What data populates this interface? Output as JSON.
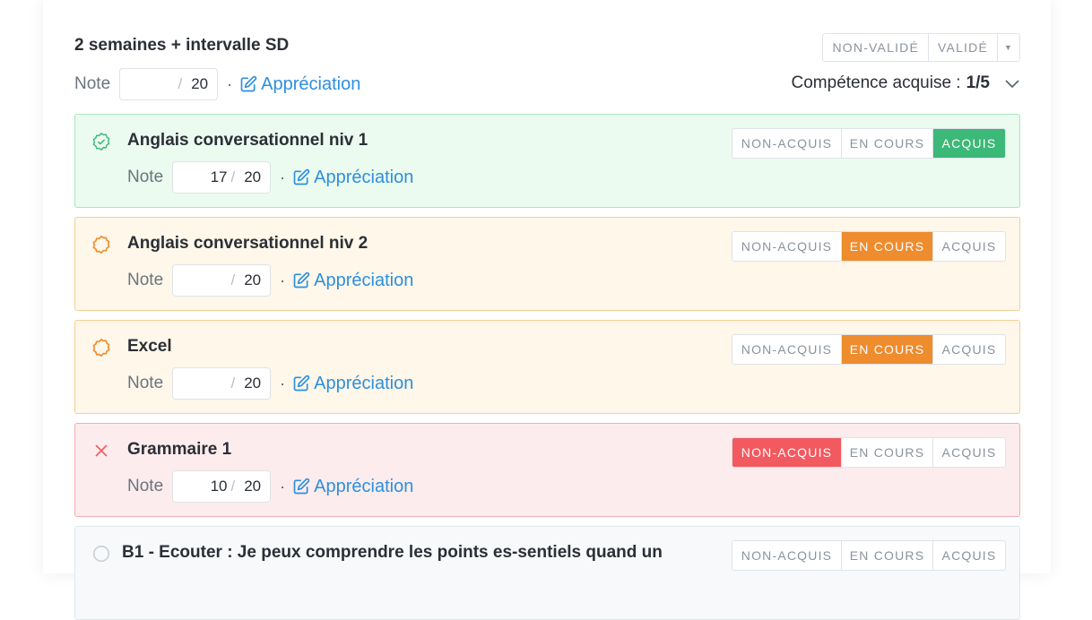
{
  "header": {
    "title": "2 semaines + intervalle SD",
    "validation_options": [
      "NON-VALIDÉ",
      "VALIDÉ"
    ]
  },
  "main_note": {
    "label": "Note",
    "value": "",
    "max": "20",
    "appreciation": "Appréciation"
  },
  "acquired": {
    "label": "Compétence acquise :",
    "count": "1/5"
  },
  "status_options": [
    "NON-ACQUIS",
    "EN COURS",
    "ACQUIS"
  ],
  "competences": [
    {
      "title": "Anglais conversationnel niv 1",
      "note_label": "Note",
      "score": "17",
      "max": "20",
      "appreciation": "Appréciation",
      "status": "ACQUIS",
      "status_color": "#3cb878"
    },
    {
      "title": "Anglais conversationnel niv 2",
      "note_label": "Note",
      "score": "",
      "max": "20",
      "appreciation": "Appréciation",
      "status": "EN COURS",
      "status_color": "#ee8c2e"
    },
    {
      "title": "Excel",
      "note_label": "Note",
      "score": "",
      "max": "20",
      "appreciation": "Appréciation",
      "status": "EN COURS",
      "status_color": "#ee8c2e"
    },
    {
      "title": "Grammaire 1",
      "note_label": "Note",
      "score": "10",
      "max": "20",
      "appreciation": "Appréciation",
      "status": "NON-ACQUIS",
      "status_color": "#f25a5f"
    },
    {
      "title": "B1 - Ecouter : Je peux comprendre les points es-sentiels quand un",
      "note_label": "Note",
      "score": "",
      "max": "20",
      "appreciation": "Appréciation",
      "status": "",
      "status_color": ""
    }
  ]
}
